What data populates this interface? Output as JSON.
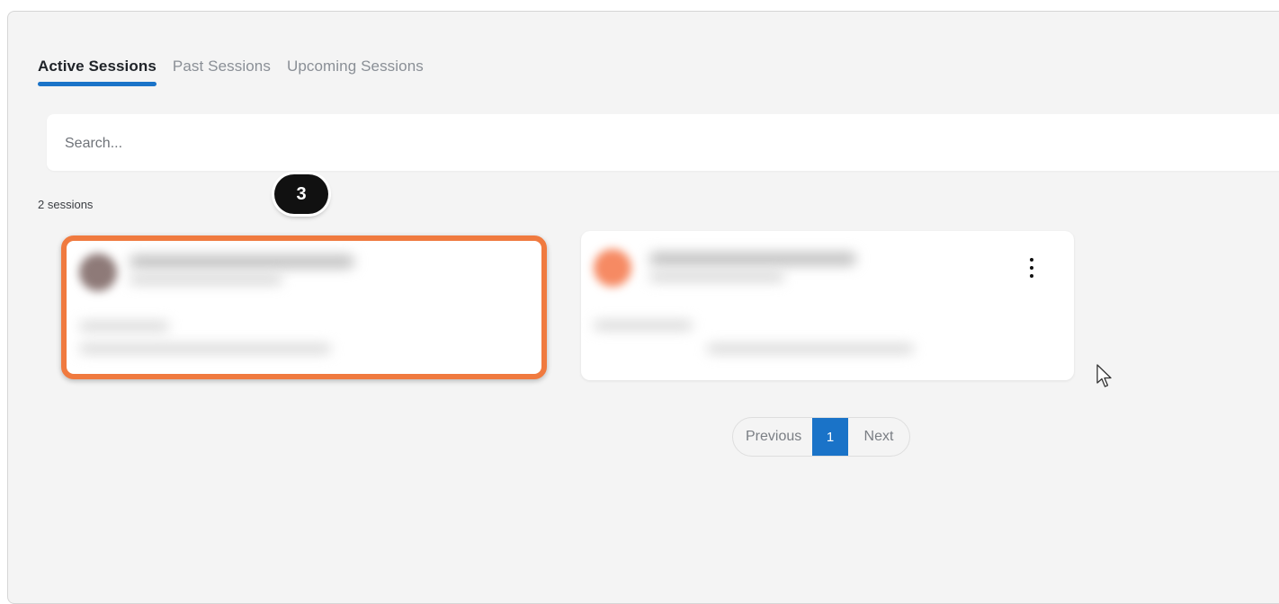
{
  "tabs": [
    {
      "label": "Active Sessions",
      "active": true
    },
    {
      "label": "Past Sessions",
      "active": false
    },
    {
      "label": "Upcoming Sessions",
      "active": false
    }
  ],
  "search": {
    "placeholder": "Search..."
  },
  "session_count": "2 sessions",
  "step_badge": "3",
  "pagination": {
    "previous": "Previous",
    "current": "1",
    "next": "Next"
  },
  "colors": {
    "accent": "#1a73c8",
    "highlight": "#f07a3f",
    "background": "#f4f4f4"
  },
  "icons": {
    "card_menu": "more-vertical-icon",
    "pointer": "mouse-cursor-icon"
  }
}
